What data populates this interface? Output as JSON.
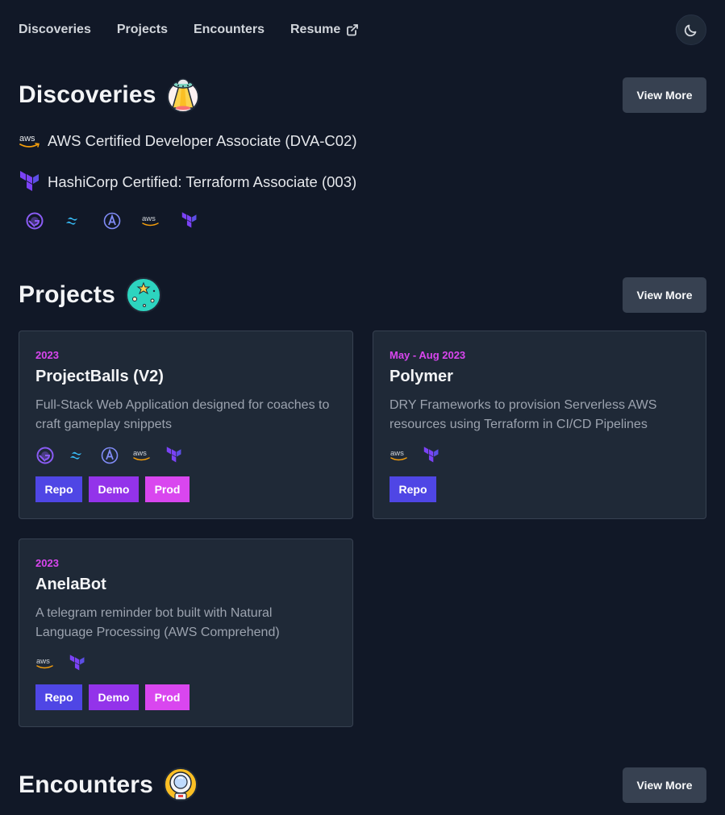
{
  "nav": {
    "links": [
      "Discoveries",
      "Projects",
      "Encounters",
      "Resume"
    ],
    "theme_toggle_icon": "moon-icon"
  },
  "discoveries": {
    "title": "Discoveries",
    "view_more": "View More",
    "certs": [
      {
        "icon": "aws-icon",
        "label": "AWS Certified Developer Associate (DVA-C02)"
      },
      {
        "icon": "terraform-icon",
        "label": "HashiCorp Certified: Terraform Associate (003)"
      }
    ],
    "tech": [
      "gatsby-icon",
      "tailwind-icon",
      "apollo-icon",
      "aws-icon",
      "terraform-icon"
    ]
  },
  "projects": {
    "title": "Projects",
    "view_more": "View More",
    "items": [
      {
        "date": "2023",
        "name": "ProjectBalls (V2)",
        "desc_line1": "Full-Stack Web Application designed for coaches to",
        "desc_line2": "craft gameplay snippets",
        "tech": [
          "gatsby-icon",
          "tailwind-icon",
          "apollo-icon",
          "aws-icon",
          "terraform-icon"
        ],
        "buttons": [
          "Repo",
          "Demo",
          "Prod"
        ]
      },
      {
        "date": "May - Aug 2023",
        "name": "Polymer",
        "desc_line1": "DRY Frameworks to provision Serverless AWS",
        "desc_line2": "resources using Terraform in CI/CD Pipelines",
        "tech": [
          "aws-icon",
          "terraform-icon"
        ],
        "buttons": [
          "Repo"
        ]
      },
      {
        "date": "2023",
        "name": "AnelaBot",
        "desc_line1": "A telegram reminder bot built with Natural",
        "desc_line2": "Language Processing (AWS Comprehend)",
        "tech": [
          "aws-icon",
          "terraform-icon"
        ],
        "buttons": [
          "Repo",
          "Demo",
          "Prod"
        ]
      }
    ]
  },
  "encounters": {
    "title": "Encounters",
    "view_more": "View More"
  },
  "colors": {
    "background": "#111827",
    "card": "#1f2937",
    "accent_date": "#d946ef",
    "repo": "#4f46e5",
    "demo": "#9333ea",
    "prod": "#d946ef"
  }
}
